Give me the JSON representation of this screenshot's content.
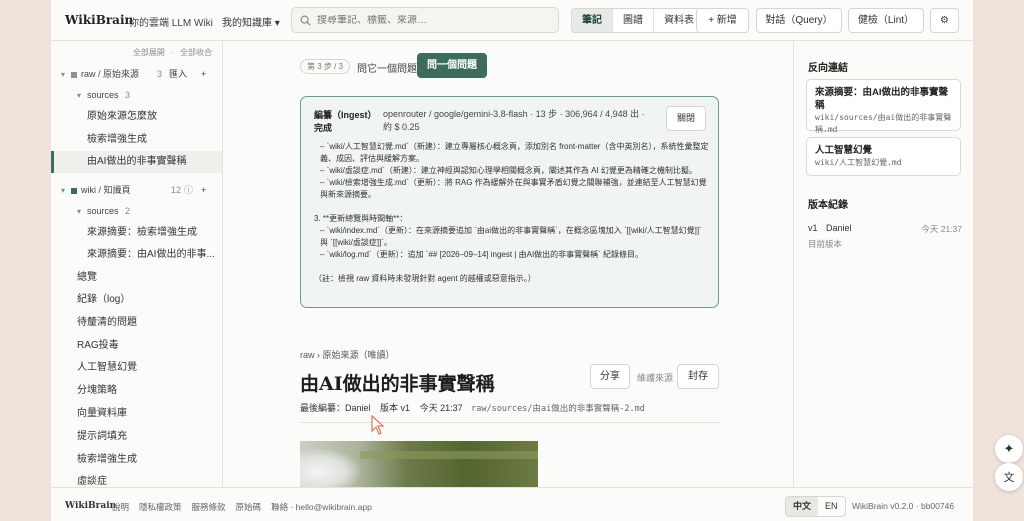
{
  "header": {
    "logo": "WikiBrain",
    "tagline": "你的雲端 LLM Wiki",
    "kb_select": "我的知識庫 ▾",
    "search_placeholder": "搜尋筆記、標籤、來源…",
    "view_tabs": [
      "筆記",
      "圖譜",
      "資料表"
    ],
    "active_tab": "筆記",
    "new_label": "+ 新增",
    "chat_label": "對話（Query）",
    "lint_label": "健檢（Lint）",
    "settings_icon": "gear-icon"
  },
  "sidebar": {
    "expand_all": "全部展開",
    "separator": "·",
    "collapse_all": "全部收合",
    "raw_group": {
      "label": "raw / 原始來源",
      "count": "3",
      "import": "匯入",
      "add": "+",
      "color": "#8f8f8f"
    },
    "raw_sources": {
      "label": "sources",
      "count": "3"
    },
    "raw_items": [
      "原始來源怎麼放",
      "檢索增強生成",
      "由AI做出的非事實聲稱"
    ],
    "active_item": "由AI做出的非事實聲稱",
    "wiki_group": {
      "label": "wiki / 知識頁",
      "count": "12",
      "info": "ⓘ",
      "add": "+",
      "color": "#3f6b5d"
    },
    "wiki_sources": {
      "label": "sources",
      "count": "2"
    },
    "wiki_source_items": [
      "來源摘要：檢索增強生成",
      "來源摘要：由AI做出的非事..."
    ],
    "wiki_items": [
      "總覽",
      "紀錄（log）",
      "待釐清的問題",
      "RAG投毒",
      "人工智慧幻覺",
      "分塊策略",
      "向量資料庫",
      "提示詞填充",
      "檢索增強生成",
      "虛談症"
    ]
  },
  "main": {
    "step_badge": "第 3 步 / 3",
    "ask_other": "問它一個問題",
    "ask_button": "問一個問題",
    "ingest": {
      "title_line1": "編纂（Ingest）",
      "title_line2": "完成",
      "meta": "openrouter / google/gemini-3.8-flash · 13 步 · 306,964 / 4,948 出 · 約 $ 0.25",
      "close": "關閉",
      "lines": [
        "– `wiki/人工智慧幻覺.md`（新建）：建立專屬核心概念頁，添加別名 front-matter（含中英別名），系統性彙整定義、成因、評估與緩解方案。",
        "– `wiki/虛談症.md`（新建）：建立神經與認知心理學相關概念頁，闡述其作為 AI 幻覺更為精確之機制比擬。",
        "– `wiki/檢索增強生成.md`（更新）：將 RAG 作為緩解外在與事實矛盾幻覺之關聯補強，並連結至人工智慧幻覺與新來源摘要。",
        "",
        "3. **更新總覽與時間軸**：",
        "– `wiki/index.md`（更新）：在來源摘要追加 `由ai做出的非事實聲稱`，在概念區塊加入 `[[wiki/人工智慧幻覺]]` 與 `[[wiki/虛談症]]`。",
        "– `wiki/log.md`（更新）：追加 `## [2026–09–14] ingest | 由AI做出的非事實聲稱` 紀錄條目。",
        "",
        "（註：檢視 raw 資料時未發現針對 agent 的越權或惡意指示。）"
      ]
    },
    "breadcrumb": "raw › 原始來源（唯讀）",
    "doc_title": "由AI做出的非事實聲稱",
    "share": "分享",
    "maintain": "維護來源",
    "archive": "封存",
    "last_edit": "最後編纂：Daniel",
    "version": "版本 v1",
    "time": "今天 21:37",
    "path": "raw/sources/由ai做出的非事實聲稱-2.md"
  },
  "right": {
    "backlinks_title": "反向連結",
    "backlinks": [
      {
        "title": "來源摘要：由AI做出的非事實聲稱",
        "path": "wiki/sources/由ai做出的非事實聲稱.md"
      },
      {
        "title": "人工智慧幻覺",
        "path": "wiki/人工智慧幻覺.md"
      }
    ],
    "versions_title": "版本紀錄",
    "version_entry": {
      "ver": "v1",
      "author": "Daniel",
      "time": "今天 21:37"
    },
    "current": "目前版本"
  },
  "footer": {
    "logo": "WikiBrain",
    "links": [
      "說明",
      "隱私權政策",
      "服務條款",
      "原始碼",
      "聯絡 · hello@wikibrain.app"
    ],
    "langs": [
      "中文",
      "EN"
    ],
    "active_lang": "中文",
    "version": "WikiBrain v0.2.0 · bb00746"
  },
  "floating": {
    "sparkle_icon": "sparkle-icon",
    "translate_icon": "translate-icon"
  },
  "colors": {
    "accent": "#3f6b5d",
    "panel_border": "#6f9a88",
    "panel_bg": "#f1f5f1"
  }
}
